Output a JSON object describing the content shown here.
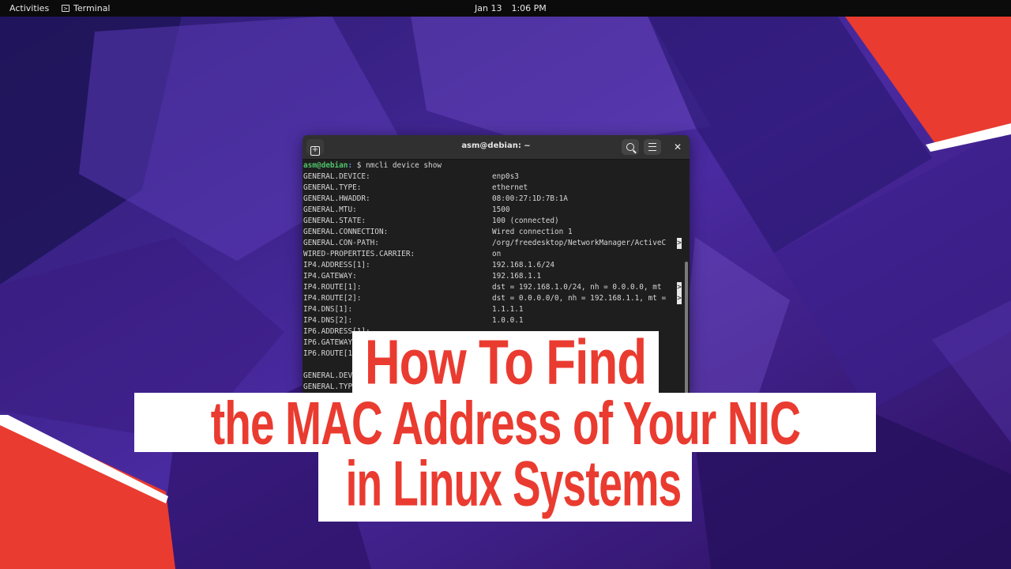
{
  "topbar": {
    "activities": "Activities",
    "app_name": "Terminal",
    "date": "Jan 13",
    "time": "1:06 PM"
  },
  "terminal": {
    "title": "asm@debian: ~",
    "prompt_user": "asm@debian",
    "prompt_path": ":",
    "prompt_tail": " $ nmcli device show",
    "lines": [
      {
        "k": "GENERAL.DEVICE:",
        "v": "enp0s3"
      },
      {
        "k": "GENERAL.TYPE:",
        "v": "ethernet"
      },
      {
        "k": "GENERAL.HWADDR:",
        "v": "08:00:27:1D:7B:1A"
      },
      {
        "k": "GENERAL.MTU:",
        "v": "1500"
      },
      {
        "k": "GENERAL.STATE:",
        "v": "100 (connected)"
      },
      {
        "k": "GENERAL.CONNECTION:",
        "v": "Wired connection 1"
      },
      {
        "k": "GENERAL.CON-PATH:",
        "v": "/org/freedesktop/NetworkManager/ActiveC",
        "t": ">"
      },
      {
        "k": "WIRED-PROPERTIES.CARRIER:",
        "v": "on"
      },
      {
        "k": "IP4.ADDRESS[1]:",
        "v": "192.168.1.6/24"
      },
      {
        "k": "IP4.GATEWAY:",
        "v": "192.168.1.1"
      },
      {
        "k": "IP4.ROUTE[1]:",
        "v": "dst = 192.168.1.0/24, nh = 0.0.0.0, mt",
        "t": ">"
      },
      {
        "k": "IP4.ROUTE[2]:",
        "v": "dst = 0.0.0.0/0, nh = 192.168.1.1, mt =",
        "t": ">"
      },
      {
        "k": "IP4.DNS[1]:",
        "v": "1.1.1.1"
      },
      {
        "k": "IP4.DNS[2]:",
        "v": "1.0.0.1"
      },
      {
        "k": "IP6.ADDRESS[1]:",
        "v": ""
      },
      {
        "k": "IP6.GATEWAY",
        "v": ""
      },
      {
        "k": "IP6.ROUTE[1",
        "v": ""
      },
      {
        "k": "",
        "v": ""
      },
      {
        "k": "GENERAL.DEV",
        "v": ""
      },
      {
        "k": "GENERAL.TYP",
        "v": ""
      }
    ]
  },
  "headline": {
    "line1": "How To Find",
    "line2": "the MAC Address of Your NIC",
    "line3": "in Linux Systems"
  },
  "colors": {
    "accent_red": "#ea3b30",
    "prompt_green": "#4fc36b"
  }
}
